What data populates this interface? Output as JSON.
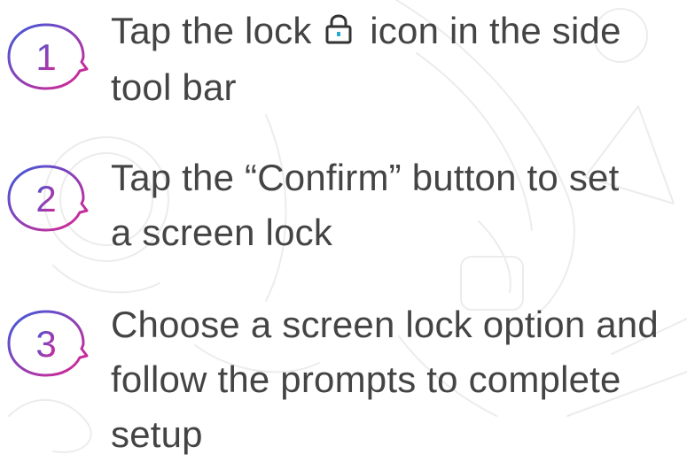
{
  "steps": [
    {
      "number": "1",
      "text_before_icon": "Tap the lock",
      "icon": "lock-icon",
      "text_after_icon": "icon in the side tool bar"
    },
    {
      "number": "2",
      "text": "Tap the “Confirm” button to set a screen lock"
    },
    {
      "number": "3",
      "text": "Choose a screen lock option and follow the prompts to complete setup"
    }
  ],
  "colors": {
    "text": "#444444",
    "badge_gradient_start": "#3b5bdb",
    "badge_gradient_end": "#e0248f",
    "lock_icon": "#333333",
    "lock_keyhole": "#2aa7d6",
    "doodle": "#ececec"
  }
}
